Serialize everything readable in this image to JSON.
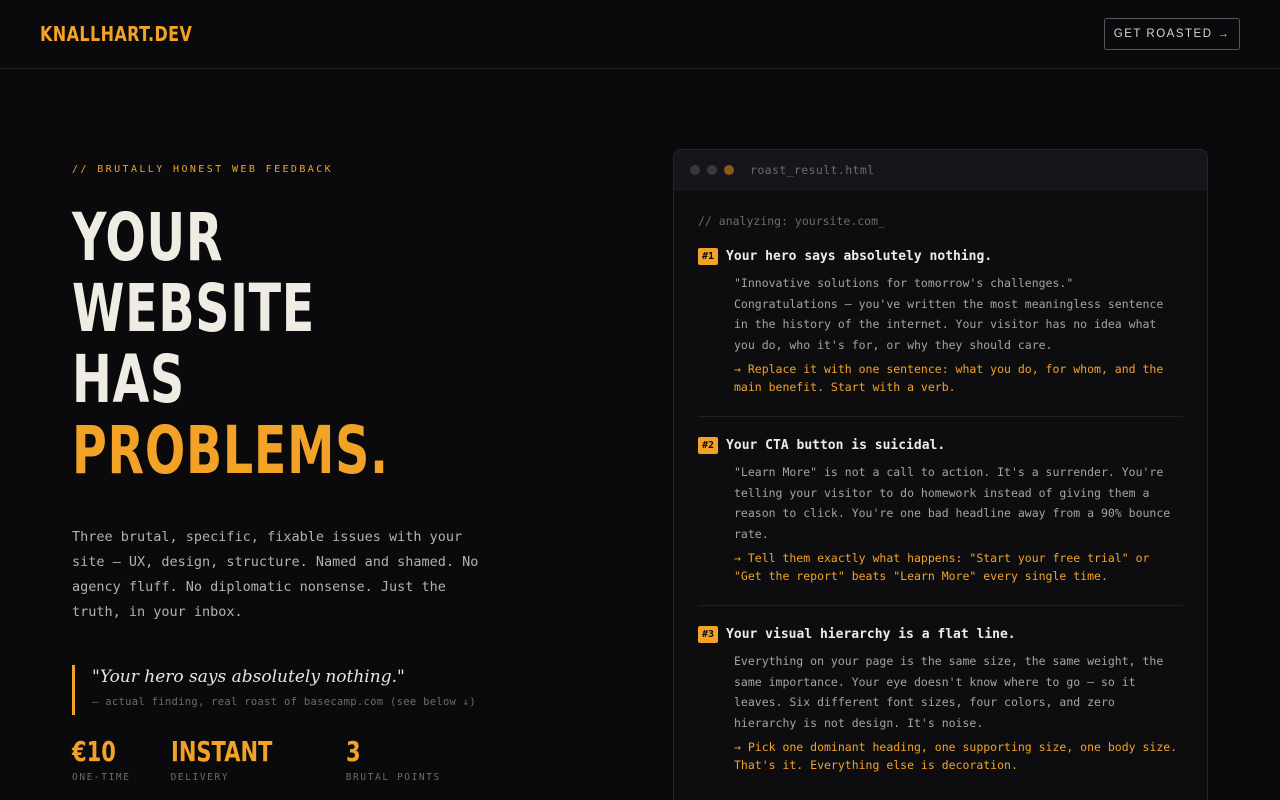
{
  "nav": {
    "logo": "KNALLHART.DEV",
    "cta": "GET ROASTED →"
  },
  "hero": {
    "eyebrow": "// BRUTALLY HONEST WEB FEEDBACK",
    "headline": [
      "YOUR",
      "WEBSITE",
      "HAS"
    ],
    "headline_accent": "PROBLEMS.",
    "lede": "Three brutal, specific, fixable issues with your site — UX, design, structure. Named and shamed. No agency fluff. No diplomatic nonsense. Just the truth, in your inbox.",
    "quote": "\"Your hero says absolutely nothing.\"",
    "quote_caption": "— actual finding, real roast of basecamp.com (see below ↓)",
    "stats": [
      {
        "value": "€10",
        "label": "ONE-TIME"
      },
      {
        "value": "INSTANT",
        "label": "DELIVERY"
      },
      {
        "value": "3",
        "label": "BRUTAL POINTS"
      }
    ]
  },
  "panel": {
    "filename": "roast_result.html",
    "analyzing": "// analyzing: yoursite.com_",
    "findings": [
      {
        "num": "#1",
        "title": "Your hero says absolutely nothing.",
        "body": "\"Innovative solutions for tomorrow's challenges.\" Congratulations — you've written the most meaningless sentence in the history of the internet. Your visitor has no idea what you do, who it's for, or why they should care.",
        "fix": "→ Replace it with one sentence: what you do, for whom, and the main benefit. Start with a verb."
      },
      {
        "num": "#2",
        "title": "Your CTA button is suicidal.",
        "body": "\"Learn More\" is not a call to action. It's a surrender. You're telling your visitor to do homework instead of giving them a reason to click. You're one bad headline away from a 90% bounce rate.",
        "fix": "→ Tell them exactly what happens: \"Start your free trial\" or \"Get the report\" beats \"Learn More\" every single time."
      },
      {
        "num": "#3",
        "title": "Your visual hierarchy is a flat line.",
        "body": "Everything on your page is the same size, the same weight, the same importance. Your eye doesn't know where to go — so it leaves. Six different font sizes, four colors, and zero hierarchy is not design. It's noise.",
        "fix": "→ Pick one dominant heading, one supporting size, one body size. That's it. Everything else is decoration."
      }
    ]
  },
  "colors": {
    "accent": "#f2a227",
    "background": "#0a0a0c",
    "text": "#efece4"
  }
}
